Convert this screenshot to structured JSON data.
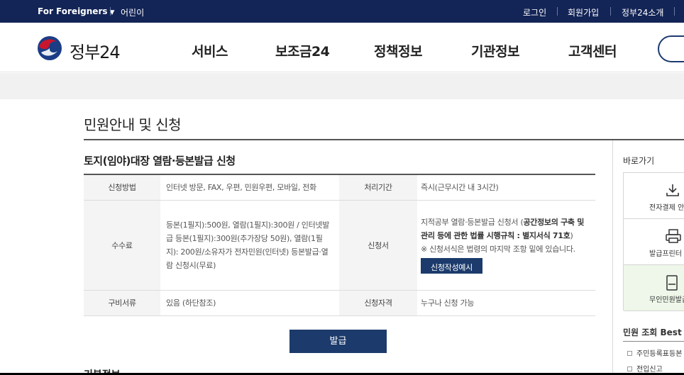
{
  "topbar": {
    "foreigners": "For Foreigners",
    "kids": "어린이",
    "login": "로그인",
    "signup": "회원가입",
    "intro": "정부24소개"
  },
  "header": {
    "logo_text": "정부24",
    "nav": [
      "서비스",
      "보조금24",
      "정책정보",
      "기관정보",
      "고객센터"
    ]
  },
  "page": {
    "title": "민원안내 및 신청",
    "section_title": "토지(임야)대장 열람·등본발급 신청"
  },
  "table": {
    "method_label": "신청방법",
    "method_value": "인터넷 방문, FAX, 우편, 민원우편, 모바일, 전화",
    "period_label": "처리기간",
    "period_value": "즉시(근무시간 내 3시간)",
    "fee_label": "수수료",
    "fee_value": "등본(1필지):500원, 열람(1필지):300원 / 인터넷발급 등본(1필지):300원(추가장당 50원), 열람(1필지): 200원/소유자가 전자민원(인터넷) 등본발급·열람 신청시(무료)",
    "form_label": "신청서",
    "form_value_pre": "지적공부 열람·등본발급 신청서 (",
    "form_value_bold": "공간정보의 구축 및 관리 등에 관한 법률 시행규칙 : 별지서식 71호",
    "form_value_post": ")",
    "form_note": "※ 신청서식은 법령의 마지막 조항 밑에 있습니다.",
    "form_button": "신청작성예시",
    "docs_label": "구비서류",
    "docs_value": "있음 (하단참조)",
    "qual_label": "신청자격",
    "qual_value": "누구나 신청 가능"
  },
  "issue_button": "발급",
  "bottom_heading_partial": "기본정보",
  "sidebar": {
    "title": "바로가기",
    "quick": [
      {
        "label": "전자결제 안",
        "icon": "download-icon"
      },
      {
        "label": "발급프린터 안",
        "icon": "printer-icon"
      },
      {
        "label": "무인민원발급",
        "icon": "kiosk-icon"
      }
    ],
    "best_title": "민원 조회 Best",
    "best_items": [
      "주민등록표등본",
      "전입신고"
    ]
  },
  "colors": {
    "topbar": "#132456",
    "primary_button": "#1c3b6c",
    "green_tile": "#eef7e9"
  }
}
